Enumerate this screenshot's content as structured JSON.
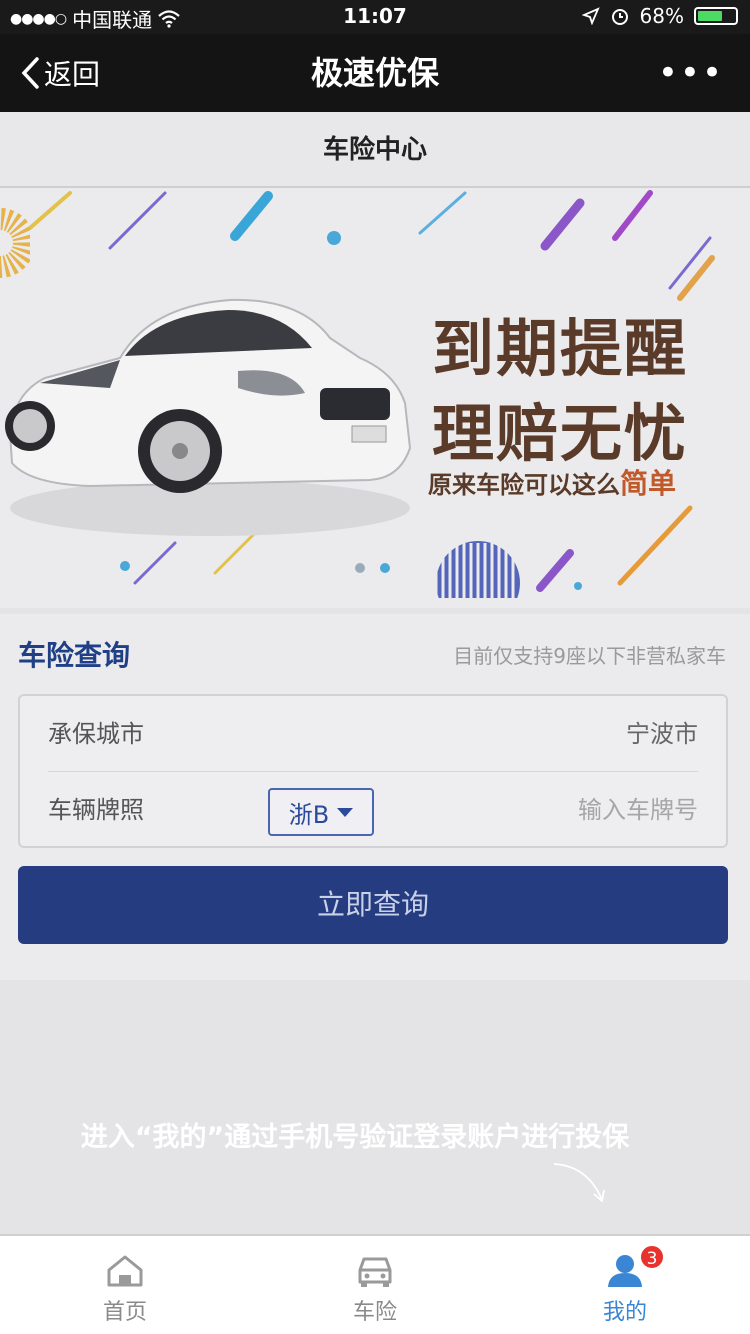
{
  "status_bar": {
    "signal_dots": "●●●●○",
    "carrier": "中国联通",
    "time": "11:07",
    "battery_percent": "68%",
    "battery_level": 0.68
  },
  "nav": {
    "back_label": "返回",
    "title": "极速优保",
    "more": "•••"
  },
  "sub_header": {
    "title": "车险中心"
  },
  "banner": {
    "headline_line1": "到期提醒",
    "headline_line2": "理赔无忧",
    "tagline_prefix": "原来车险可以这么",
    "tagline_accent": "简单"
  },
  "query": {
    "title": "车险查询",
    "note": "目前仅支持9座以下非营私家车",
    "city_label": "承保城市",
    "city_value": "宁波市",
    "plate_label": "车辆牌照",
    "plate_prefix": "浙B",
    "plate_placeholder": "输入车牌号",
    "submit_label": "立即查询"
  },
  "hint": {
    "text": "进入“我的”通过手机号验证登录账户进行投保"
  },
  "tabs": [
    {
      "label": "首页",
      "icon": "home-icon",
      "active": false
    },
    {
      "label": "车险",
      "icon": "car-icon",
      "active": false
    },
    {
      "label": "我的",
      "icon": "user-icon",
      "active": true,
      "badge": "3"
    }
  ],
  "colors": {
    "primary_dark": "#263c80",
    "tab_active": "#3a86d4",
    "badge": "#e8322e"
  }
}
